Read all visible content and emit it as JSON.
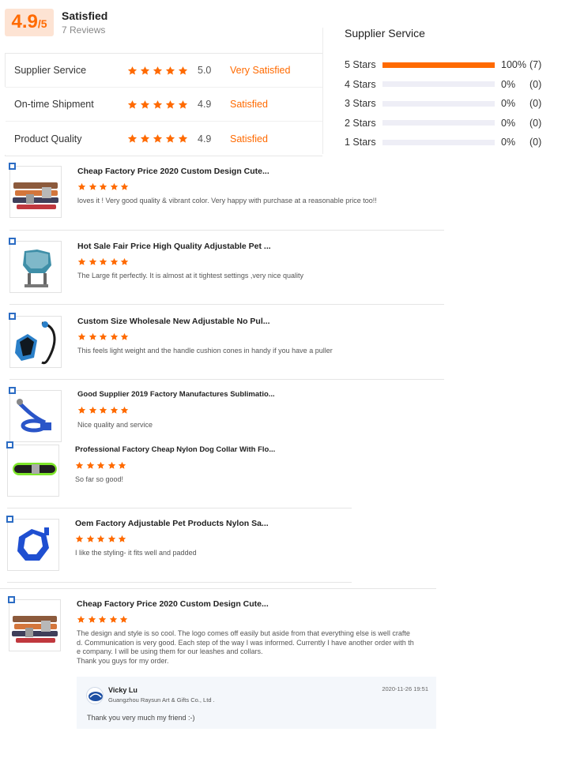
{
  "summary": {
    "score": "4.9",
    "score_suffix": "/5",
    "label": "Satisfied",
    "reviews": "7 Reviews"
  },
  "ratings": [
    {
      "label": "Supplier Service",
      "score": "5.0",
      "text": "Very Satisfied"
    },
    {
      "label": "On-time Shipment",
      "score": "4.9",
      "text": "Satisfied"
    },
    {
      "label": "Product Quality",
      "score": "4.9",
      "text": "Satisfied"
    }
  ],
  "distribution": {
    "title": "Supplier Service",
    "rows": [
      {
        "label": "5 Stars",
        "fraction": 1.0,
        "pct": "100%",
        "count": "(7)"
      },
      {
        "label": "4 Stars",
        "fraction": 0.0,
        "pct": "0%",
        "count": "(0)"
      },
      {
        "label": "3 Stars",
        "fraction": 0.0,
        "pct": "0%",
        "count": "(0)"
      },
      {
        "label": "2 Stars",
        "fraction": 0.0,
        "pct": "0%",
        "count": "(0)"
      },
      {
        "label": "1 Stars",
        "fraction": 0.0,
        "pct": "0%",
        "count": "(0)"
      }
    ]
  },
  "reviews": [
    {
      "title": "Cheap Factory Price 2020 Custom Design Cute...",
      "stars": 5,
      "body": "loves it ! Very good quality & vibrant color. Very happy with purchase at a reasonable price too!!",
      "thumb": "collar-icon"
    },
    {
      "title": "Hot Sale Fair Price High Quality Adjustable Pet ...",
      "stars": 5,
      "body": "The Large fit perfectly. It is almost at it tightest settings ,very nice quality",
      "thumb": "harness-icon"
    },
    {
      "title": "Custom Size Wholesale New Adjustable No Pul...",
      "stars": 5,
      "body": "This feels light weight and the handle cushion cones in handy if you have a puller",
      "thumb": "leash-harness-icon"
    },
    {
      "title": "Good Supplier 2019 Factory Manufactures Sublimatio...",
      "stars": 5,
      "body": "Nice quality and service",
      "thumb": "leash-icon"
    },
    {
      "title": "Professional Factory Cheap Nylon Dog Collar With Flo...",
      "stars": 5,
      "body": "So far so good!",
      "thumb": "reflective-collar-icon"
    },
    {
      "title": "Oem Factory Adjustable Pet Products Nylon Sa...",
      "stars": 5,
      "body": "I like the styling- it fits well and padded",
      "thumb": "blue-harness-icon"
    },
    {
      "title": "Cheap Factory Price 2020 Custom Design Cute...",
      "stars": 5,
      "body_lines": [
        "The design and style is so cool. The logo comes off easily but aside from that everything else is well crafte",
        "d. Communication is very good. Each step of the way I was informed. Currently  I have another order with th",
        "e company. I will be using them for our leashes and collars.",
        "Thank you guys for my order."
      ],
      "thumb": "collar-icon"
    }
  ],
  "reply": {
    "name": "Vicky Lu",
    "company": "Guangzhou Raysun Art & Gifts Co., Ltd .",
    "date": "2020-11-26 19:51",
    "text": "Thank you very much my friend :-)"
  },
  "colors": {
    "accent": "#ff6a00",
    "score_bg": "#fde3d3"
  }
}
